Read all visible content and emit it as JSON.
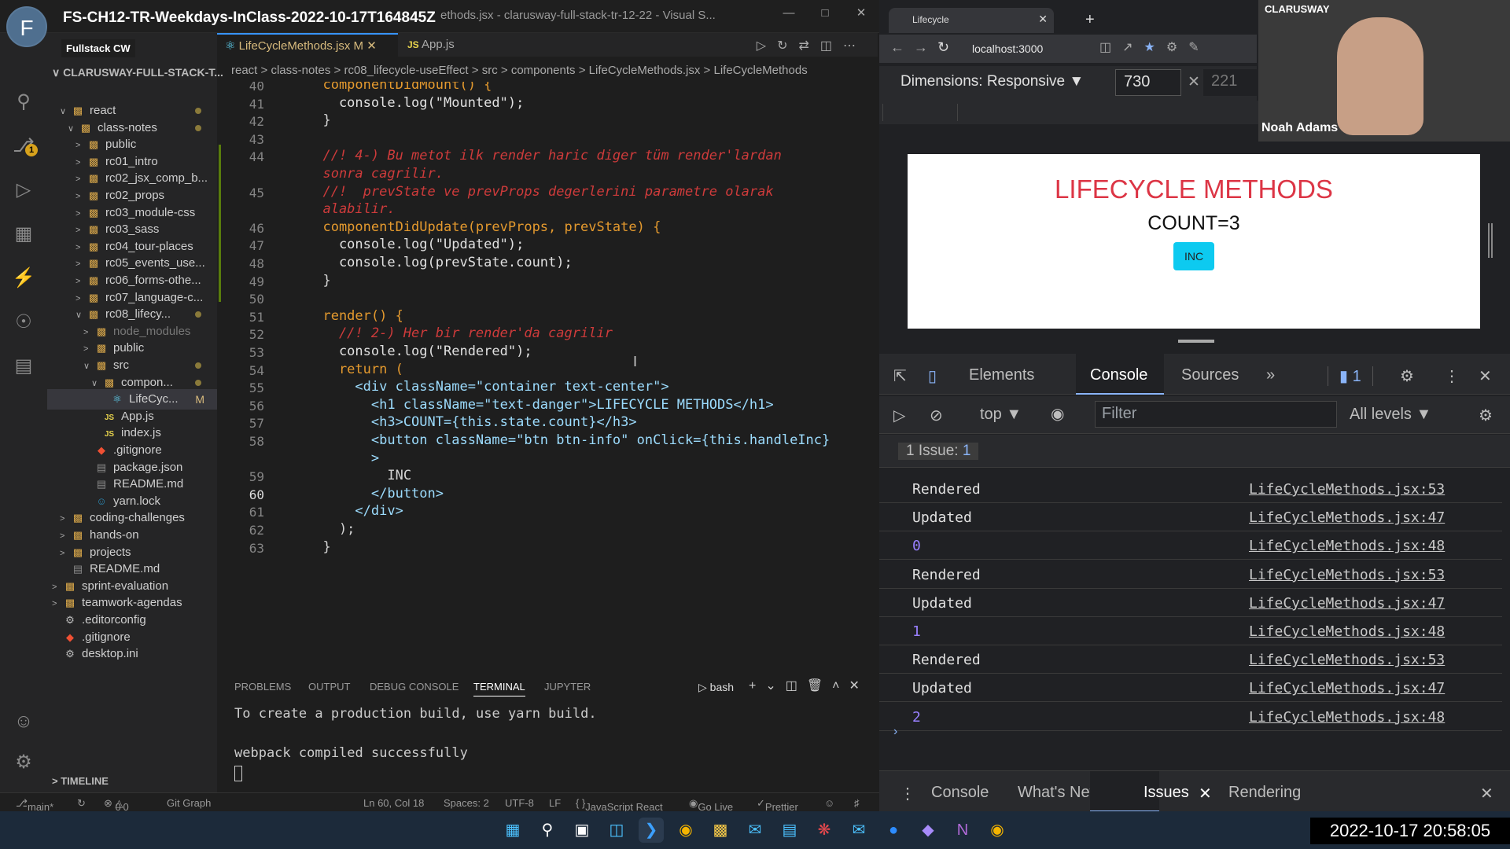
{
  "meeting_title": "FS-CH12-TR-Weekdays-InClass-2022-10-17T164845Z",
  "vscode": {
    "window_title_tail": "ethods.jsx - clarusway-full-stack-tr-12-22 - Visual S...",
    "sidebar_label": "Fullstack CW",
    "explorer_root": "CLARUSWAY-FULL-STACK-T...",
    "tree": [
      {
        "label": "react",
        "icon": "folder-icon",
        "indent": 1,
        "arrow": "v",
        "dot": true
      },
      {
        "label": "class-notes",
        "icon": "folder-icon",
        "indent": 2,
        "arrow": "v",
        "dot": true
      },
      {
        "label": "public",
        "icon": "folder-icon",
        "indent": 3,
        "arrow": ">"
      },
      {
        "label": "rc01_intro",
        "icon": "folder-icon",
        "indent": 3,
        "arrow": ">"
      },
      {
        "label": "rc02_jsx_comp_b...",
        "icon": "folder-icon",
        "indent": 3,
        "arrow": ">"
      },
      {
        "label": "rc02_props",
        "icon": "folder-icon",
        "indent": 3,
        "arrow": ">"
      },
      {
        "label": "rc03_module-css",
        "icon": "folder-icon",
        "indent": 3,
        "arrow": ">"
      },
      {
        "label": "rc03_sass",
        "icon": "folder-icon",
        "indent": 3,
        "arrow": ">"
      },
      {
        "label": "rc04_tour-places",
        "icon": "folder-icon",
        "indent": 3,
        "arrow": ">"
      },
      {
        "label": "rc05_events_use...",
        "icon": "folder-icon",
        "indent": 3,
        "arrow": ">"
      },
      {
        "label": "rc06_forms-othe...",
        "icon": "folder-icon",
        "indent": 3,
        "arrow": ">"
      },
      {
        "label": "rc07_language-c...",
        "icon": "folder-icon",
        "indent": 3,
        "arrow": ">"
      },
      {
        "label": "rc08_lifecy...",
        "icon": "folder-icon",
        "indent": 3,
        "arrow": "v",
        "dot": true
      },
      {
        "label": "node_modules",
        "icon": "folder-icon",
        "indent": 4,
        "arrow": ">",
        "dim": true
      },
      {
        "label": "public",
        "icon": "folder-icon",
        "indent": 4,
        "arrow": ">"
      },
      {
        "label": "src",
        "icon": "folder-icon",
        "indent": 4,
        "arrow": "v",
        "dot": true
      },
      {
        "label": "compon...",
        "icon": "folder-icon",
        "indent": 5,
        "arrow": "v",
        "dot": true
      },
      {
        "label": "LifeCyc...",
        "icon": "react-icon",
        "indent": 6,
        "arrow": "",
        "mark": "M",
        "selected": true
      },
      {
        "label": "App.js",
        "icon": "js-icon",
        "indent": 5,
        "arrow": ""
      },
      {
        "label": "index.js",
        "icon": "js-icon",
        "indent": 5,
        "arrow": ""
      },
      {
        "label": ".gitignore",
        "icon": "git-icon",
        "indent": 4,
        "arrow": ""
      },
      {
        "label": "package.json",
        "icon": "file-icon",
        "indent": 4,
        "arrow": ""
      },
      {
        "label": "README.md",
        "icon": "file-icon",
        "indent": 4,
        "arrow": ""
      },
      {
        "label": "yarn.lock",
        "icon": "yarn-icon",
        "indent": 4,
        "arrow": ""
      },
      {
        "label": "coding-challenges",
        "icon": "folder-icon",
        "indent": 1,
        "arrow": ">"
      },
      {
        "label": "hands-on",
        "icon": "folder-icon",
        "indent": 1,
        "arrow": ">"
      },
      {
        "label": "projects",
        "icon": "folder-icon",
        "indent": 1,
        "arrow": ">"
      },
      {
        "label": "README.md",
        "icon": "file-icon",
        "indent": 1,
        "arrow": ""
      },
      {
        "label": "sprint-evaluation",
        "icon": "folder-icon",
        "indent": 0,
        "arrow": ">"
      },
      {
        "label": "teamwork-agendas",
        "icon": "folder-icon",
        "indent": 0,
        "arrow": ">"
      },
      {
        "label": ".editorconfig",
        "icon": "gear-icon",
        "indent": 0,
        "arrow": ""
      },
      {
        "label": ".gitignore",
        "icon": "git-icon",
        "indent": 0,
        "arrow": ""
      },
      {
        "label": "desktop.ini",
        "icon": "gear-icon",
        "indent": 0,
        "arrow": ""
      }
    ],
    "timeline_label": "TIMELINE",
    "tabs": [
      {
        "label": "LifeCycleMethods.jsx",
        "mark": "M",
        "active": true
      },
      {
        "label": "App.js",
        "prefix": "JS",
        "active": false
      }
    ],
    "breadcrumb": [
      "react",
      "class-notes",
      "rc08_lifecycle-useEffect",
      "src",
      "components",
      "LifeCycleMethods.jsx",
      "LifeCycleMethods"
    ],
    "lines": [
      {
        "n": "40",
        "text": "  componentDidMount() {"
      },
      {
        "n": "41",
        "text": "    console.log(\"Mounted\");"
      },
      {
        "n": "42",
        "text": "  }"
      },
      {
        "n": "43",
        "text": ""
      },
      {
        "n": "44",
        "text": "  //! 4-) Bu metot ilk render haric diger tüm render'lardan",
        "cls": "cm"
      },
      {
        "n": "",
        "text": "  sonra cagrilir.",
        "cls": "cm"
      },
      {
        "n": "45",
        "text": "  //!  prevState ve prevProps degerlerini parametre olarak",
        "cls": "cm"
      },
      {
        "n": "",
        "text": "  alabilir.",
        "cls": "cm"
      },
      {
        "n": "46",
        "text": "  componentDidUpdate(prevProps, prevState) {"
      },
      {
        "n": "47",
        "text": "    console.log(\"Updated\");"
      },
      {
        "n": "48",
        "text": "    console.log(prevState.count);"
      },
      {
        "n": "49",
        "text": "  }"
      },
      {
        "n": "50",
        "text": ""
      },
      {
        "n": "51",
        "text": "  render() {"
      },
      {
        "n": "52",
        "text": "    //! 2-) Her bir render'da cagrilir",
        "cls": "cm"
      },
      {
        "n": "53",
        "text": "    console.log(\"Rendered\");"
      },
      {
        "n": "54",
        "text": "    return ("
      },
      {
        "n": "55",
        "text": "      <div className=\"container text-center\">"
      },
      {
        "n": "56",
        "text": "        <h1 className=\"text-danger\">LIFECYCLE METHODS</h1>"
      },
      {
        "n": "57",
        "text": "        <h3>COUNT={this.state.count}</h3>"
      },
      {
        "n": "58",
        "text": "        <button className=\"btn btn-info\" onClick={this.handleInc}"
      },
      {
        "n": "",
        "text": "        >"
      },
      {
        "n": "59",
        "text": "          INC"
      },
      {
        "n": "60",
        "text": "        </button>"
      },
      {
        "n": "61",
        "text": "      </div>"
      },
      {
        "n": "62",
        "text": "    );"
      },
      {
        "n": "63",
        "text": "  }"
      }
    ],
    "panel_tabs": [
      "PROBLEMS",
      "OUTPUT",
      "DEBUG CONSOLE",
      "TERMINAL",
      "JUPYTER"
    ],
    "terminal_shell": "bash",
    "terminal": [
      "To create a production build, use yarn build.",
      "",
      "webpack compiled successfully"
    ],
    "status": {
      "branch": "main*",
      "errors": "0",
      "warnings": "0",
      "git_graph": "Git Graph",
      "position": "Ln 60, Col 18",
      "spaces": "Spaces: 2",
      "encoding": "UTF-8",
      "eol": "LF",
      "language": "JavaScript React",
      "go_live": "Go Live",
      "prettier": "Prettier"
    }
  },
  "browser": {
    "tab_title": "Lifecycle",
    "url": "localhost:3000",
    "dimensions_label": "Dimensions: Responsive",
    "width": "730",
    "height_placeholder": "221",
    "page": {
      "h1": "LIFECYCLE METHODS",
      "h3": "COUNT=3",
      "button": "INC"
    },
    "devtools": {
      "tabs": [
        "Elements",
        "Console",
        "Sources"
      ],
      "active_tab": "Console",
      "issues_count": "1",
      "context": "top",
      "filter_placeholder": "Filter",
      "levels": "All levels",
      "issues_label": "1 Issue:",
      "console_rows": [
        {
          "msg": "Rendered",
          "src": "LifeCycleMethods.jsx:53"
        },
        {
          "msg": "Updated",
          "src": "LifeCycleMethods.jsx:47"
        },
        {
          "msg": "0",
          "src": "LifeCycleMethods.jsx:48",
          "num": true
        },
        {
          "msg": "Rendered",
          "src": "LifeCycleMethods.jsx:53"
        },
        {
          "msg": "Updated",
          "src": "LifeCycleMethods.jsx:47"
        },
        {
          "msg": "1",
          "src": "LifeCycleMethods.jsx:48",
          "num": true
        },
        {
          "msg": "Rendered",
          "src": "LifeCycleMethods.jsx:53"
        },
        {
          "msg": "Updated",
          "src": "LifeCycleMethods.jsx:47"
        },
        {
          "msg": "2",
          "src": "LifeCycleMethods.jsx:48",
          "num": true
        }
      ],
      "drawer_tabs": [
        "Console",
        "What's New",
        "Issues",
        "Rendering"
      ],
      "drawer_active": "Issues"
    }
  },
  "video": {
    "name": "Noah Adams",
    "logo": "CLARUSWAY"
  },
  "taskbar": {
    "clock": "2022-10-17  20:58:05"
  }
}
